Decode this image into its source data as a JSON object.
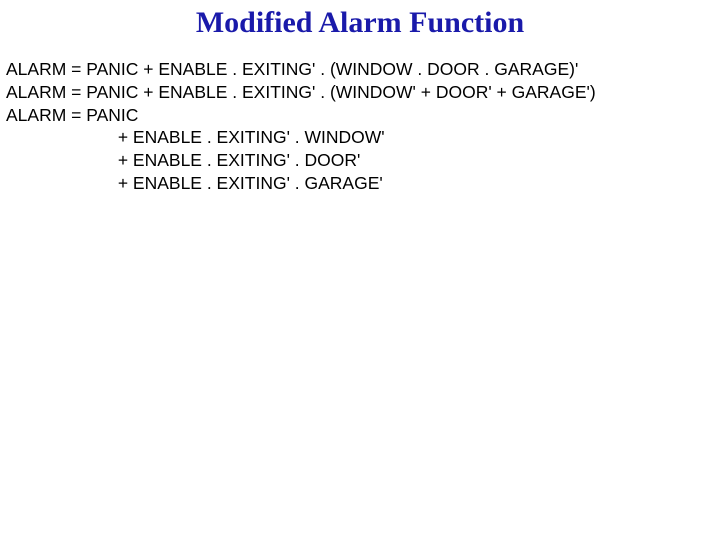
{
  "title": "Modified Alarm Function",
  "lines": {
    "l1": "ALARM = PANIC + ENABLE . EXITING' . (WINDOW . DOOR . GARAGE)'",
    "l2": "ALARM = PANIC + ENABLE . EXITING' . (WINDOW' + DOOR' + GARAGE')",
    "l3": "ALARM = PANIC",
    "l4": "                       + ENABLE . EXITING' . WINDOW'",
    "l5": "                       + ENABLE . EXITING' . DOOR'",
    "l6": "                       + ENABLE . EXITING' . GARAGE'"
  }
}
